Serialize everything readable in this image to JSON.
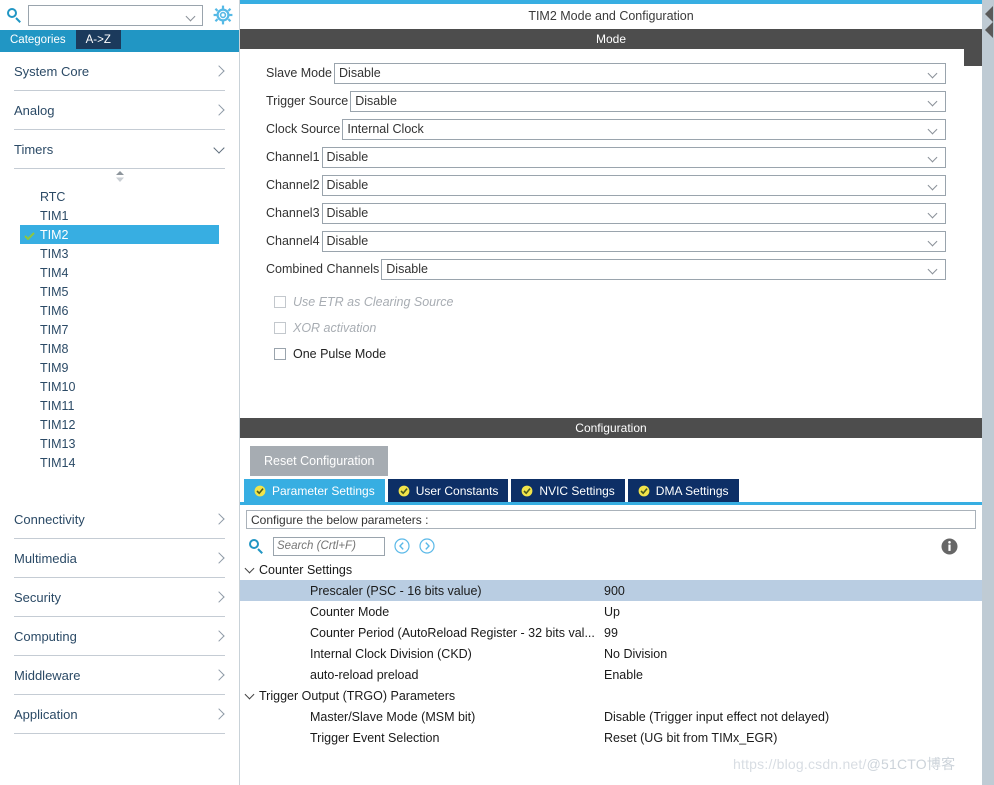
{
  "sidebar": {
    "search": {
      "value": "",
      "icon": "search-icon"
    },
    "gear_icon": "gear-icon",
    "az_tabs": [
      {
        "label": "Categories",
        "active": false
      },
      {
        "label": "A->Z",
        "active": true
      }
    ],
    "categories": [
      {
        "label": "System Core",
        "expanded": false
      },
      {
        "label": "Analog",
        "expanded": false
      },
      {
        "label": "Timers",
        "expanded": true
      }
    ],
    "timers": [
      {
        "label": "RTC",
        "selected": false,
        "checked": false
      },
      {
        "label": "TIM1",
        "selected": false,
        "checked": false
      },
      {
        "label": "TIM2",
        "selected": true,
        "checked": true
      },
      {
        "label": "TIM3",
        "selected": false,
        "checked": false
      },
      {
        "label": "TIM4",
        "selected": false,
        "checked": false
      },
      {
        "label": "TIM5",
        "selected": false,
        "checked": false
      },
      {
        "label": "TIM6",
        "selected": false,
        "checked": false
      },
      {
        "label": "TIM7",
        "selected": false,
        "checked": false
      },
      {
        "label": "TIM8",
        "selected": false,
        "checked": false
      },
      {
        "label": "TIM9",
        "selected": false,
        "checked": false
      },
      {
        "label": "TIM10",
        "selected": false,
        "checked": false
      },
      {
        "label": "TIM11",
        "selected": false,
        "checked": false
      },
      {
        "label": "TIM12",
        "selected": false,
        "checked": false
      },
      {
        "label": "TIM13",
        "selected": false,
        "checked": false
      },
      {
        "label": "TIM14",
        "selected": false,
        "checked": false
      }
    ],
    "categories_bottom": [
      {
        "label": "Connectivity",
        "expanded": false
      },
      {
        "label": "Multimedia",
        "expanded": false
      },
      {
        "label": "Security",
        "expanded": false
      },
      {
        "label": "Computing",
        "expanded": false
      },
      {
        "label": "Middleware",
        "expanded": false
      },
      {
        "label": "Application",
        "expanded": false
      }
    ]
  },
  "main": {
    "title": "TIM2 Mode and Configuration",
    "mode_band": "Mode",
    "mode_fields": [
      {
        "label": "Slave Mode",
        "value": "Disable"
      },
      {
        "label": "Trigger Source",
        "value": "Disable"
      },
      {
        "label": "Clock Source",
        "value": "Internal Clock"
      },
      {
        "label": "Channel1",
        "value": "Disable"
      },
      {
        "label": "Channel2",
        "value": "Disable"
      },
      {
        "label": "Channel3",
        "value": "Disable"
      },
      {
        "label": "Channel4",
        "value": "Disable"
      },
      {
        "label": "Combined Channels",
        "value": "Disable"
      }
    ],
    "mode_checkboxes": [
      {
        "label": "Use ETR as Clearing Source",
        "checked": false,
        "disabled": true
      },
      {
        "label": "XOR activation",
        "checked": false,
        "disabled": true
      },
      {
        "label": "One Pulse Mode",
        "checked": false,
        "disabled": false
      }
    ],
    "config_band": "Configuration",
    "reset_button": "Reset Configuration",
    "tabs": [
      {
        "label": "Parameter Settings",
        "active": true
      },
      {
        "label": "User Constants",
        "active": false
      },
      {
        "label": "NVIC Settings",
        "active": false
      },
      {
        "label": "DMA Settings",
        "active": false
      }
    ],
    "configure_note": "Configure the below parameters :",
    "param_search": {
      "placeholder": "Search (Crtl+F)",
      "value": ""
    },
    "param_groups": [
      {
        "name": "Counter Settings",
        "rows": [
          {
            "name": "Prescaler (PSC - 16 bits value)",
            "value": "900",
            "selected": true
          },
          {
            "name": "Counter Mode",
            "value": "Up",
            "selected": false
          },
          {
            "name": "Counter Period (AutoReload Register - 32 bits val...",
            "value": "99",
            "selected": false
          },
          {
            "name": "Internal Clock Division (CKD)",
            "value": "No Division",
            "selected": false
          },
          {
            "name": "auto-reload preload",
            "value": "Enable",
            "selected": false
          }
        ]
      },
      {
        "name": "Trigger Output (TRGO) Parameters",
        "rows": [
          {
            "name": "Master/Slave Mode (MSM bit)",
            "value": "Disable (Trigger input effect not delayed)",
            "selected": false
          },
          {
            "name": "Trigger Event Selection",
            "value": "Reset (UG bit from TIMx_EGR)",
            "selected": false
          }
        ]
      }
    ]
  },
  "watermark": {
    "url": "https://blog.csdn.net/",
    "handle": "@51CTO博客"
  },
  "colors": {
    "accent": "#37aee2",
    "tab_active": "#37aee2",
    "tab_inactive": "#0d2f66",
    "band": "#4d4d4d",
    "selected_row": "#b9cde2",
    "check_green": "#8ec63f",
    "tick_yellow": "#f2e44a"
  }
}
